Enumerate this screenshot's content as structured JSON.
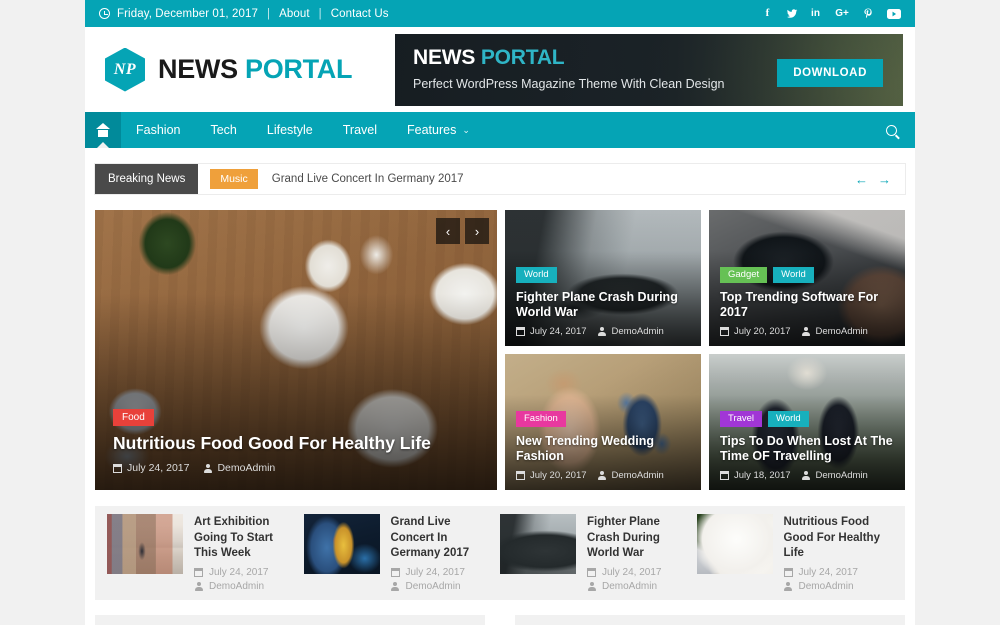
{
  "topbar": {
    "date": "Friday, December 01, 2017",
    "separator": "|",
    "links": [
      {
        "label": "About"
      },
      {
        "label": "Contact Us"
      }
    ],
    "social": [
      {
        "name": "facebook-icon",
        "glyph": "f"
      },
      {
        "name": "twitter-icon",
        "glyph": "✉"
      },
      {
        "name": "linkedin-icon",
        "glyph": "in"
      },
      {
        "name": "googleplus-icon",
        "glyph": "G+"
      },
      {
        "name": "pinterest-icon",
        "glyph": "P"
      },
      {
        "name": "youtube-icon",
        "glyph": "▶"
      }
    ]
  },
  "header": {
    "logo_mark": "NP",
    "brand_first": "NEWS",
    "brand_second": " PORTAL",
    "ad": {
      "title_first": "NEWS",
      "title_second": " PORTAL",
      "subtitle": "Perfect  WordPress Magazine Theme With Clean Design",
      "button": "DOWNLOAD"
    }
  },
  "nav": {
    "home_label": "Home",
    "items": [
      {
        "label": "Fashion",
        "has_caret": false
      },
      {
        "label": "Tech",
        "has_caret": false
      },
      {
        "label": "Lifestyle",
        "has_caret": false
      },
      {
        "label": "Travel",
        "has_caret": false
      },
      {
        "label": "Features",
        "has_caret": true
      }
    ],
    "caret": "⌄",
    "search_label": "Search"
  },
  "breaking": {
    "label": "Breaking News",
    "category": "Music",
    "headline": "Grand Live Concert In Germany 2017",
    "prev": "←",
    "next": "→"
  },
  "slider": {
    "prev": "‹",
    "next": "›",
    "badges": [
      {
        "label": "Food",
        "color": "#e8413a"
      }
    ],
    "title": "Nutritious Food Good For Healthy Life",
    "date": "July 24, 2017",
    "author": "DemoAdmin"
  },
  "featured": [
    {
      "id": "fighter-plane-crash",
      "badges": [
        {
          "label": "World",
          "color": "#17b0bd"
        }
      ],
      "title": "Fighter Plane Crash During World War",
      "date": "July 24, 2017",
      "author": "DemoAdmin"
    },
    {
      "id": "top-trending-software",
      "badges": [
        {
          "label": "Gadget",
          "color": "#66c155"
        },
        {
          "label": "World",
          "color": "#17b0bd"
        }
      ],
      "title": "Top Trending Software For 2017",
      "date": "July 20, 2017",
      "author": "DemoAdmin"
    },
    {
      "id": "new-trending-wedding-fashion",
      "badges": [
        {
          "label": "Fashion",
          "color": "#e8389f"
        }
      ],
      "title": "New Trending Wedding Fashion",
      "date": "July 20, 2017",
      "author": "DemoAdmin"
    },
    {
      "id": "tips-to-do-when-lost",
      "badges": [
        {
          "label": "Travel",
          "color": "#a136d6"
        },
        {
          "label": "World",
          "color": "#17b0bd"
        }
      ],
      "title": "Tips To Do When Lost At The Time OF Travelling",
      "date": "July 18, 2017",
      "author": "DemoAdmin"
    }
  ],
  "posts": [
    {
      "id": "art-exhibition",
      "title": "Art Exhibition Going To Start This Week",
      "date": "July 24, 2017",
      "author": "DemoAdmin"
    },
    {
      "id": "grand-live-concert",
      "title": "Grand Live Concert In Germany 2017",
      "date": "July 24, 2017",
      "author": "DemoAdmin"
    },
    {
      "id": "fighter-plane-crash-post",
      "title": "Fighter Plane Crash During World War",
      "date": "July 24, 2017",
      "author": "DemoAdmin"
    },
    {
      "id": "nutritious-food-post",
      "title": "Nutritious Food Good For Healthy Life",
      "date": "July 24, 2017",
      "author": "DemoAdmin"
    }
  ],
  "colors": {
    "accent": "#05a4b5",
    "accent_dark": "#018a9a",
    "page_bg": "#f1f1f1",
    "breaking_label": "#4a4a4a",
    "music_badge": "#efa03b"
  }
}
